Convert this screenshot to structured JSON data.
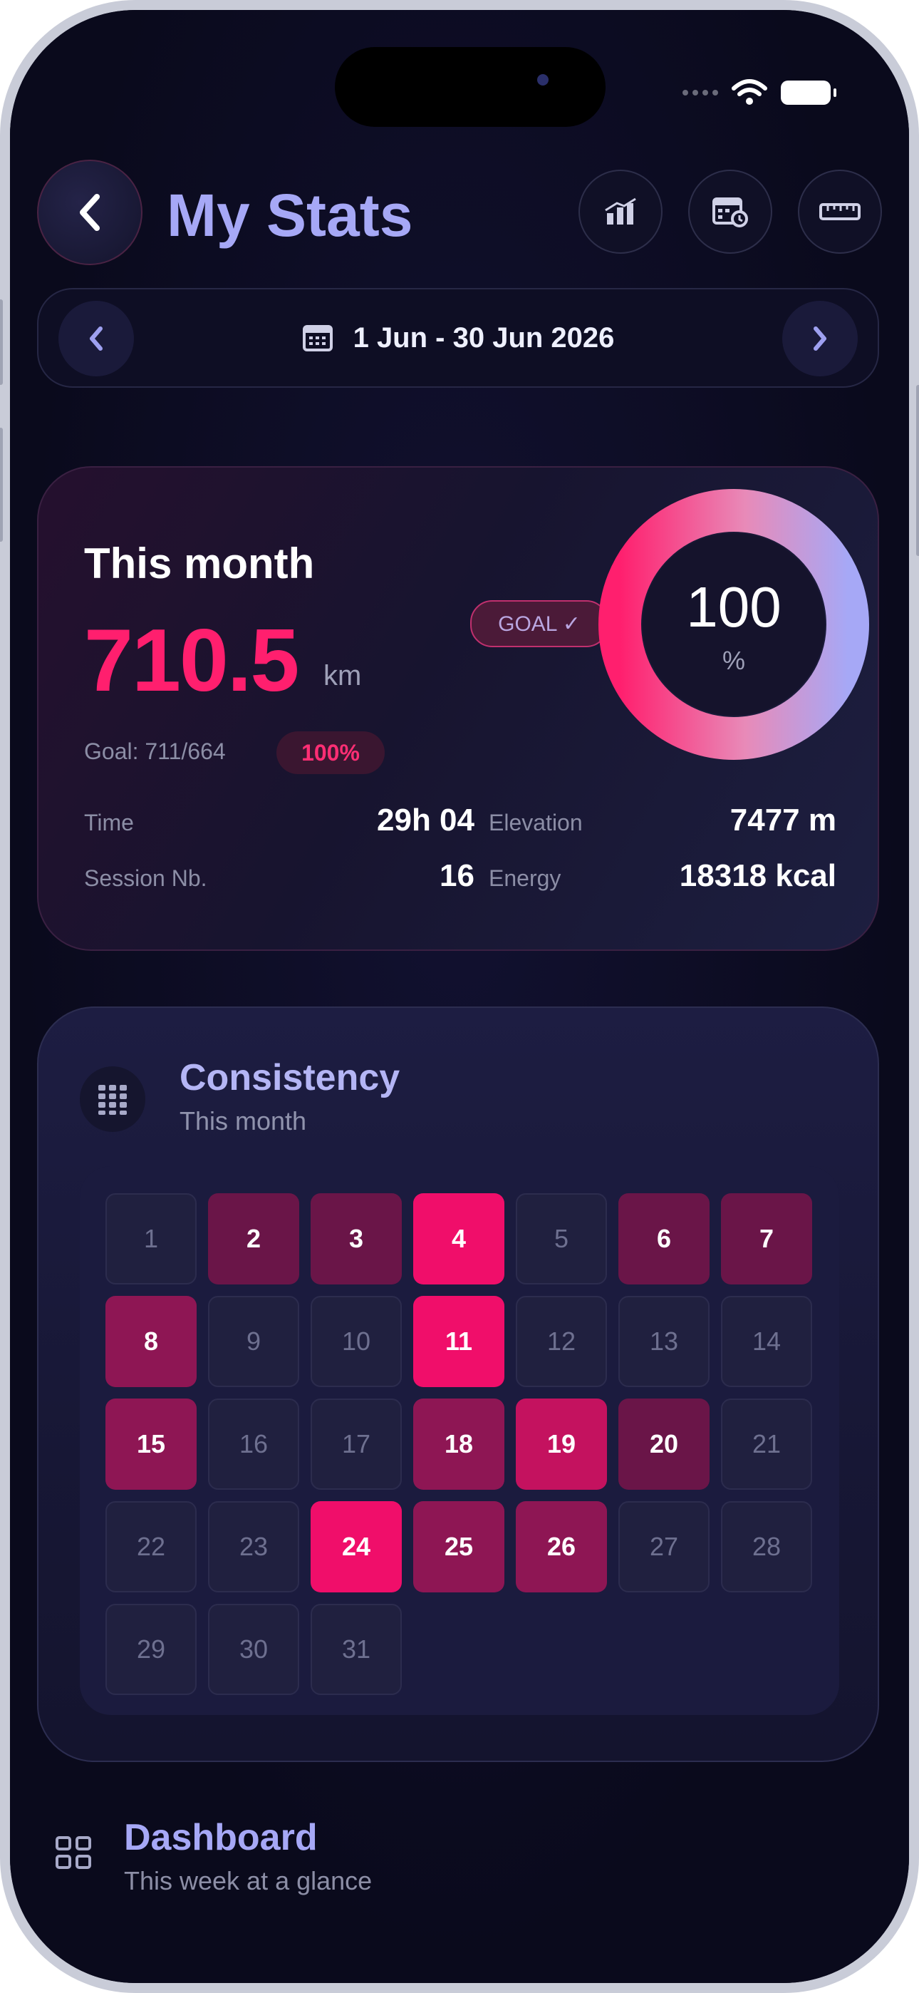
{
  "header": {
    "title": "My Stats",
    "icons": [
      "chart-icon",
      "calendar-clock-icon",
      "ruler-icon"
    ]
  },
  "date_range": {
    "label": "1 Jun - 30 Jun 2026"
  },
  "month_card": {
    "title": "This month",
    "distance": "710.5",
    "unit": "km",
    "goal_badge": "GOAL ✓",
    "goal_text": "Goal: 711/664",
    "goal_percent": "100%",
    "ring_value": "100",
    "ring_unit": "%",
    "ring_progress": 1.0,
    "stats": [
      {
        "label": "Time",
        "value": "29h 04"
      },
      {
        "label": "Session Nb.",
        "value": "16"
      },
      {
        "label": "Elevation",
        "value": "7477 m"
      },
      {
        "label": "Energy",
        "value": "18318 kcal"
      }
    ]
  },
  "consistency": {
    "title": "Consistency",
    "subtitle": "This month",
    "days": [
      {
        "day": "1",
        "level": 0
      },
      {
        "day": "2",
        "level": 1
      },
      {
        "day": "3",
        "level": 1
      },
      {
        "day": "4",
        "level": 4
      },
      {
        "day": "5",
        "level": 0
      },
      {
        "day": "6",
        "level": 1
      },
      {
        "day": "7",
        "level": 1
      },
      {
        "day": "8",
        "level": 2
      },
      {
        "day": "9",
        "level": 0
      },
      {
        "day": "10",
        "level": 0
      },
      {
        "day": "11",
        "level": 4
      },
      {
        "day": "12",
        "level": 0
      },
      {
        "day": "13",
        "level": 0
      },
      {
        "day": "14",
        "level": 0
      },
      {
        "day": "15",
        "level": 2
      },
      {
        "day": "16",
        "level": 0
      },
      {
        "day": "17",
        "level": 0
      },
      {
        "day": "18",
        "level": 2
      },
      {
        "day": "19",
        "level": 3
      },
      {
        "day": "20",
        "level": 1
      },
      {
        "day": "21",
        "level": 0
      },
      {
        "day": "22",
        "level": 0
      },
      {
        "day": "23",
        "level": 0
      },
      {
        "day": "24",
        "level": 4
      },
      {
        "day": "25",
        "level": 2
      },
      {
        "day": "26",
        "level": 2
      },
      {
        "day": "27",
        "level": 0
      },
      {
        "day": "28",
        "level": 0
      },
      {
        "day": "29",
        "level": 0
      },
      {
        "day": "30",
        "level": 0
      },
      {
        "day": "31",
        "level": 0
      }
    ]
  },
  "dashboard": {
    "title": "Dashboard",
    "subtitle": "This week at a glance"
  },
  "colors": {
    "accent_pink": "#ff1f6e",
    "accent_lavender": "#a6a8f6",
    "background": "#0b0a1d"
  }
}
